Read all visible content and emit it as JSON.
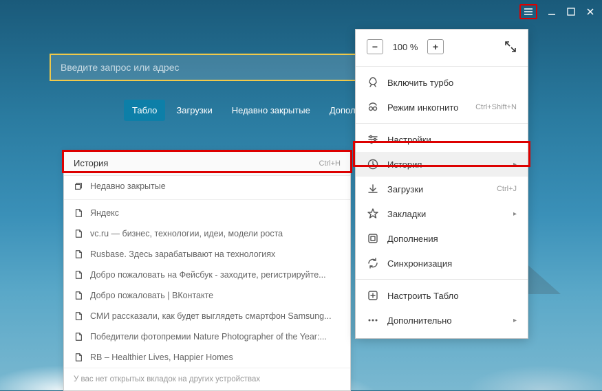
{
  "window_controls": {
    "menu": "≡",
    "minimize": "—",
    "maximize": "☐",
    "close": "✕"
  },
  "search": {
    "placeholder": "Введите запрос или адрес"
  },
  "tabs": [
    {
      "label": "Табло",
      "active": true
    },
    {
      "label": "Загрузки",
      "active": false
    },
    {
      "label": "Недавно закрытые",
      "active": false
    },
    {
      "label": "Дополнения",
      "active": false
    }
  ],
  "history_dropdown": {
    "header": "История",
    "shortcut": "Ctrl+H",
    "items": [
      {
        "icon": "restore",
        "label": "Недавно закрытые"
      },
      {
        "icon": "page",
        "label": "Яндекс"
      },
      {
        "icon": "page",
        "label": "vc.ru — бизнес, технологии, идеи, модели роста"
      },
      {
        "icon": "page",
        "label": "Rusbase. Здесь зарабатывают на технологиях"
      },
      {
        "icon": "page",
        "label": "Добро пожаловать на Фейсбук - заходите, регистрируйте..."
      },
      {
        "icon": "page",
        "label": "Добро пожаловать | ВКонтакте"
      },
      {
        "icon": "page",
        "label": "СМИ рассказали, как будет выглядеть смартфон Samsung..."
      },
      {
        "icon": "page",
        "label": "Победители фотопремии Nature Photographer of the Year:..."
      },
      {
        "icon": "page",
        "label": "RB – Healthier Lives, Happier Homes"
      }
    ],
    "footer": "У вас нет открытых вкладок на других устройствах"
  },
  "main_menu": {
    "zoom": {
      "value": "100 %"
    },
    "items": [
      {
        "icon": "rocket",
        "label": "Включить турбо"
      },
      {
        "icon": "incognito",
        "label": "Режим инкогнито",
        "shortcut": "Ctrl+Shift+N"
      },
      {
        "sep": true
      },
      {
        "icon": "settings",
        "label": "Настройки"
      },
      {
        "icon": "history",
        "label": "История",
        "submenu": true,
        "highlighted": true
      },
      {
        "icon": "download",
        "label": "Загрузки",
        "shortcut": "Ctrl+J"
      },
      {
        "icon": "star",
        "label": "Закладки",
        "submenu": true
      },
      {
        "icon": "extensions",
        "label": "Дополнения"
      },
      {
        "icon": "sync",
        "label": "Синхронизация"
      },
      {
        "sep": true
      },
      {
        "icon": "configure",
        "label": "Настроить Табло"
      },
      {
        "icon": "more",
        "label": "Дополнительно",
        "submenu": true
      }
    ]
  }
}
